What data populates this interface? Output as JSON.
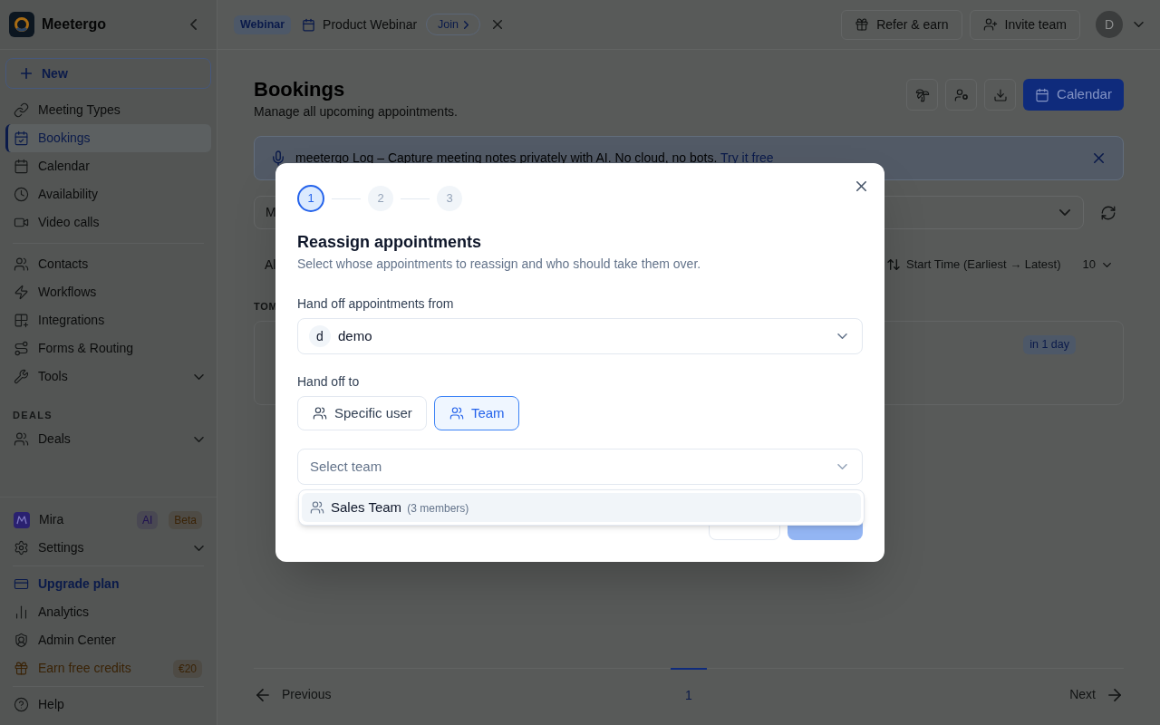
{
  "sidebar": {
    "brand": "Meetergo",
    "new_button": "New",
    "nav_groups": [
      {
        "items": [
          {
            "label": "Meeting Types",
            "selected": false
          },
          {
            "label": "Bookings",
            "selected": true
          },
          {
            "label": "Calendar",
            "selected": false
          },
          {
            "label": "Availability",
            "selected": false
          },
          {
            "label": "Video calls",
            "selected": false
          }
        ]
      },
      {
        "items": [
          {
            "label": "Contacts",
            "selected": false
          },
          {
            "label": "Workflows",
            "selected": false
          },
          {
            "label": "Integrations",
            "selected": false
          },
          {
            "label": "Forms & Routing",
            "selected": false
          },
          {
            "label": "Tools",
            "selected": false,
            "expanded": false
          }
        ]
      },
      {
        "heading": "DEALS",
        "items": [
          {
            "label": "Deals",
            "selected": false,
            "expanded": false
          }
        ]
      }
    ],
    "footer_groups": [
      {
        "items": [
          {
            "kind": "plain",
            "label": "Mira",
            "selected": false,
            "badges": [
              {
                "label": "AI",
                "color": "#1e1050"
              },
              {
                "label": "Beta",
                "color": "#3a2306"
              }
            ]
          },
          {
            "kind": "plain",
            "label": "Settings",
            "selected": false,
            "expanded": false
          }
        ]
      },
      {
        "items": [
          {
            "kind": "upgrade",
            "label": "Upgrade plan",
            "selected": false
          },
          {
            "kind": "plain",
            "label": "Analytics",
            "selected": false
          },
          {
            "kind": "plain",
            "label": "Admin Center",
            "selected": false
          },
          {
            "kind": "reward",
            "label": "Earn free credits",
            "selected": false,
            "badges": [
              {
                "label": "€20",
                "color": "#3a2306"
              }
            ]
          }
        ]
      },
      {
        "items": [
          {
            "kind": "plain",
            "label": "Help",
            "selected": false
          }
        ]
      }
    ]
  },
  "topbar": {
    "event": {
      "badge": "Webinar",
      "title": "Product Webinar",
      "join_button": "Join"
    },
    "buttons": [
      "Refer & earn",
      "Invite team"
    ],
    "avatar": "D"
  },
  "page": {
    "title": "Bookings",
    "subtitle": "Manage all upcoming appointments.",
    "primary_button": "Calendar",
    "banner": {
      "text": "meetergo Log – Capture meeting notes privately with AI. No cloud, no bots.",
      "link": "Try it free"
    },
    "filter": {
      "value": "M"
    },
    "list_text": "Al",
    "sort": "Start Time (Earliest → Latest)",
    "page_size": "10",
    "group_heading": "TOM",
    "booking_cards": [
      {
        "badge": "in 1 day"
      }
    ],
    "pagination": {
      "previous": "Previous",
      "pages": [
        {
          "label": "1",
          "selected": true
        }
      ],
      "next": "Next"
    }
  },
  "dialog": {
    "steps": [
      {
        "label": "1",
        "selected": true
      },
      {
        "label": "2",
        "selected": false
      },
      {
        "label": "3",
        "selected": false
      }
    ],
    "title": "Reassign appointments",
    "subtitle": "Select whose appointments to reassign and who should take them over.",
    "hand_off_from": {
      "label": "Hand off appointments from",
      "initial": "d",
      "value": "demo"
    },
    "hand_off_to": {
      "label": "Hand off to",
      "options": [
        {
          "label": "Specific user",
          "selected": false
        },
        {
          "label": "Team",
          "selected": true
        }
      ]
    },
    "team_select": {
      "placeholder": "Select team",
      "expanded": true,
      "options": [
        {
          "label": "Sales Team",
          "note": "(3 members)",
          "highlighted": true
        }
      ]
    },
    "footer_buttons": [
      {
        "kind": "outline",
        "disabled": false
      },
      {
        "kind": "filled",
        "disabled": true
      }
    ]
  }
}
